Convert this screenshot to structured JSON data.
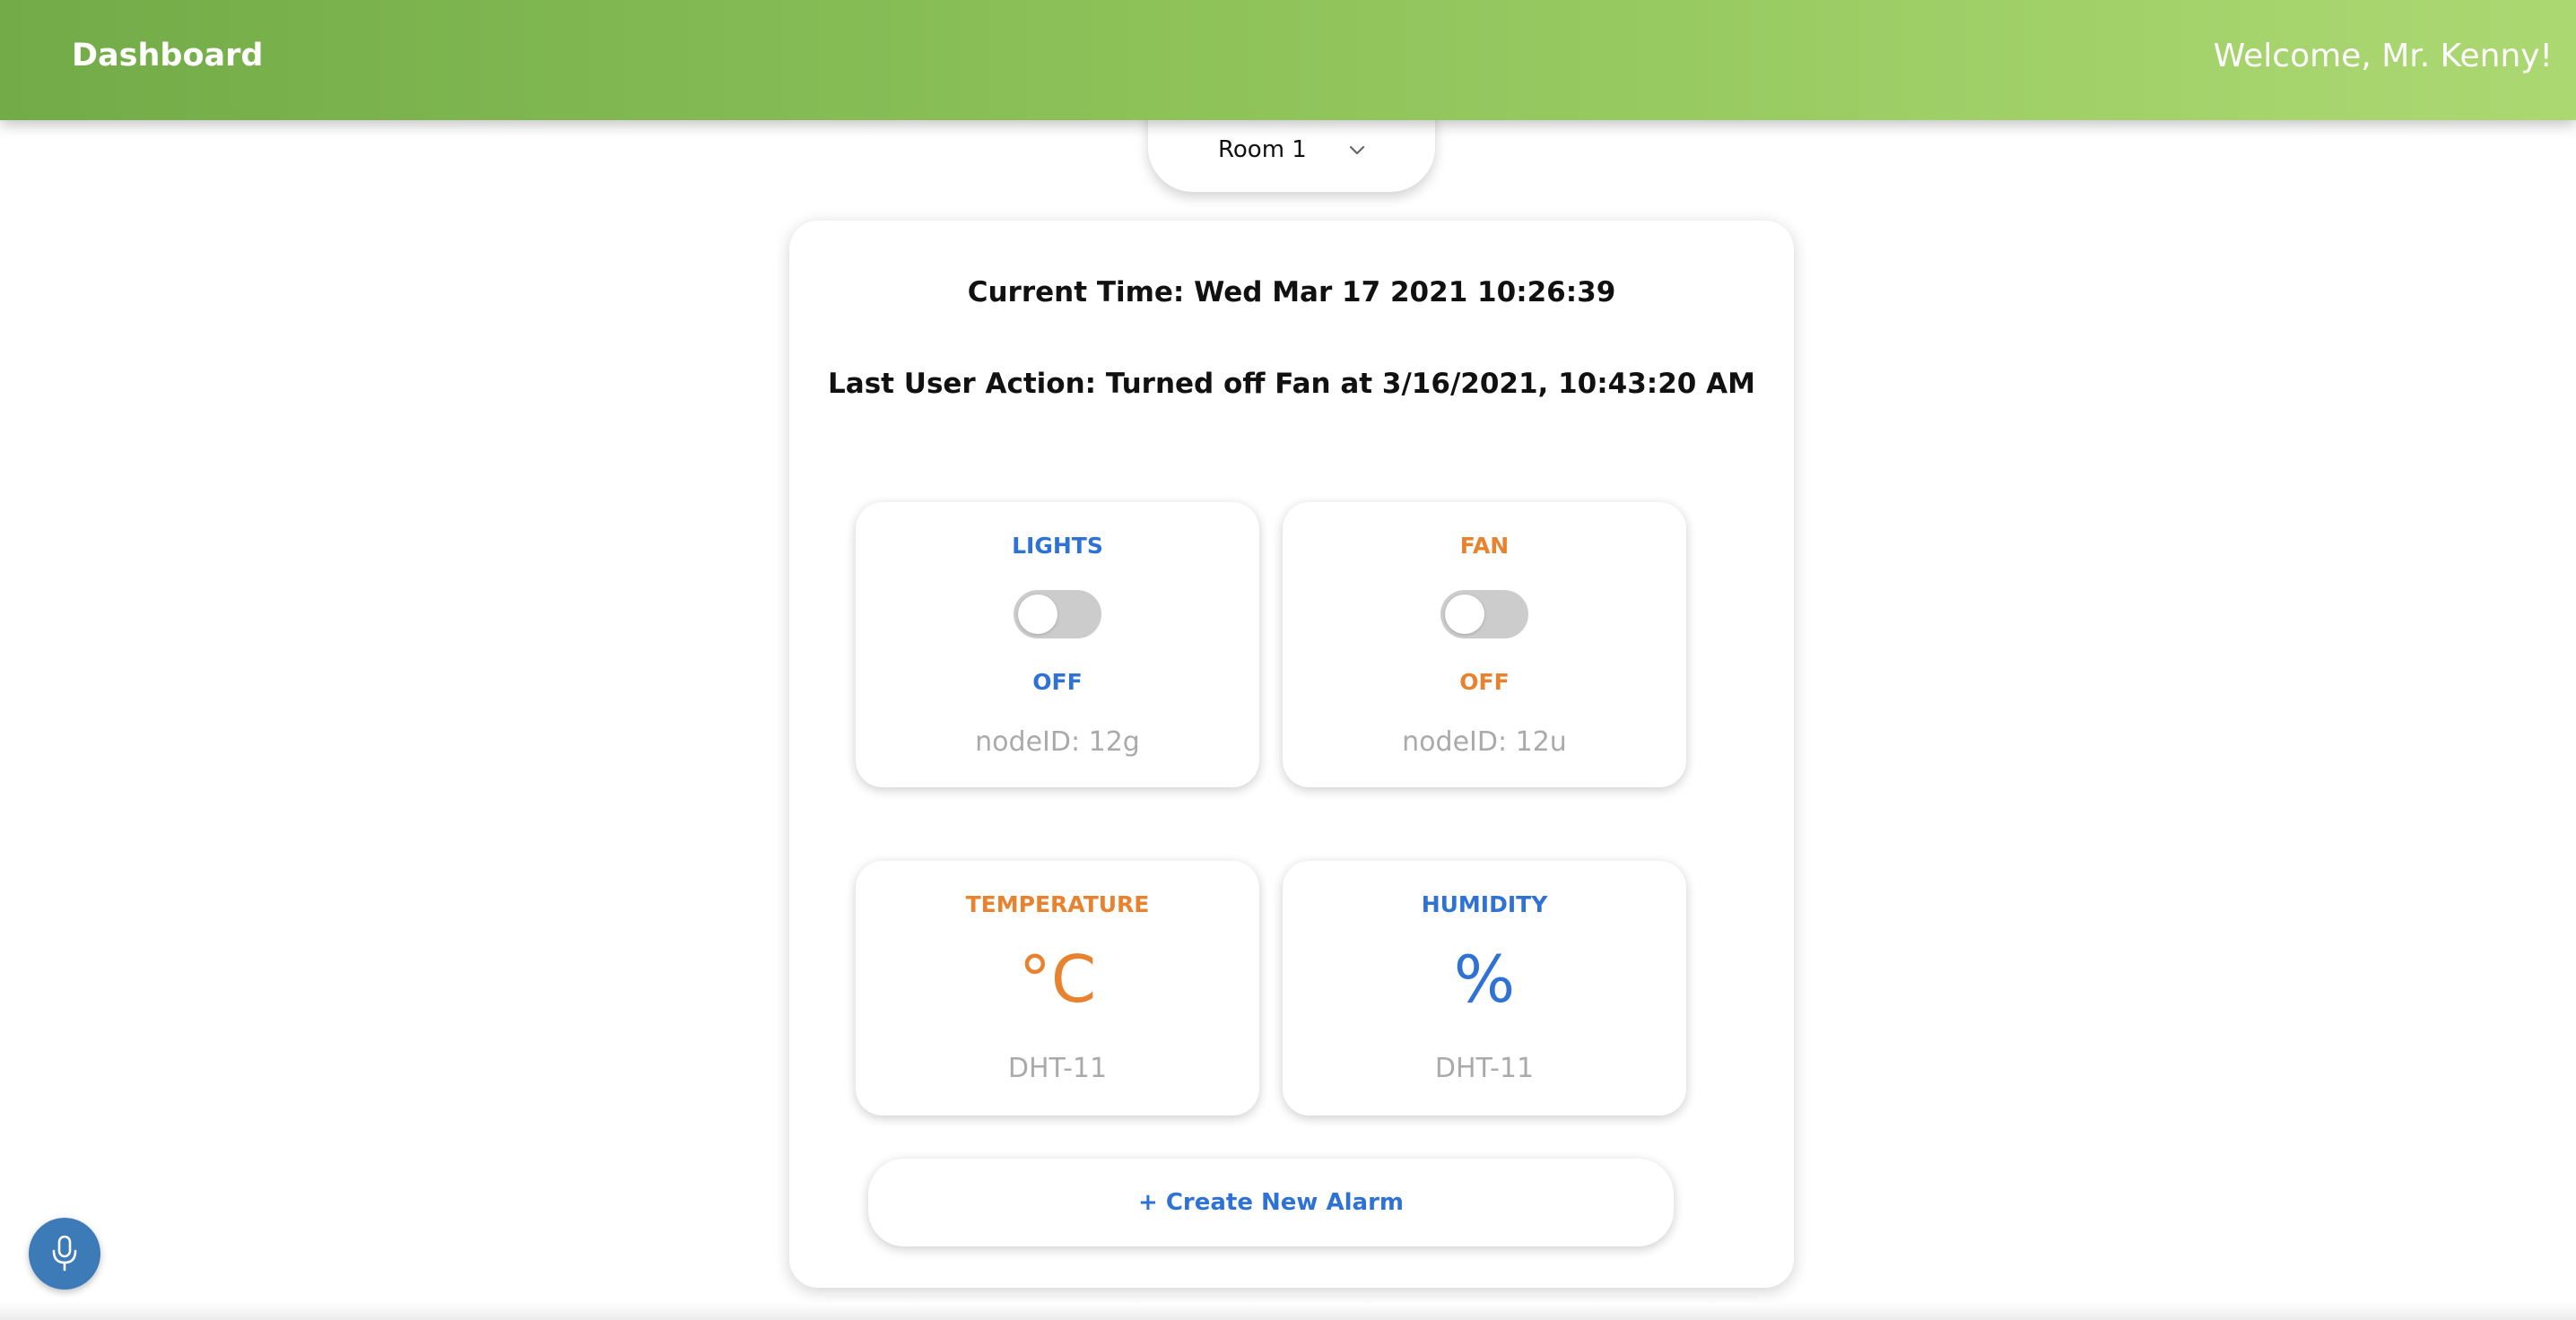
{
  "header": {
    "title": "Dashboard",
    "welcome": "Welcome, Mr. Kenny!"
  },
  "room_selector": {
    "selected": "Room 1"
  },
  "status": {
    "current_time": "Current Time: Wed Mar 17 2021 10:26:39",
    "last_action": "Last User Action: Turned off Fan at 3/16/2021, 10:43:20 AM"
  },
  "devices": [
    {
      "title": "LIGHTS",
      "state": "OFF",
      "node": "nodeID: 12g",
      "on": false
    },
    {
      "title": "FAN",
      "state": "OFF",
      "node": "nodeID: 12u",
      "on": false
    }
  ],
  "sensors": [
    {
      "title": "TEMPERATURE",
      "value": "°C",
      "source": "DHT-11"
    },
    {
      "title": "HUMIDITY",
      "value": "%",
      "source": "DHT-11"
    }
  ],
  "alarm": {
    "label": "+ Create New Alarm"
  },
  "icons": {
    "room_dropdown": "chevron-down-icon",
    "voice": "microphone-icon"
  },
  "colors": {
    "header_start": "#72ab48",
    "header_end": "#acd872",
    "blue": "#2f72d6",
    "orange": "#e8822e",
    "mic_button": "#3d7ab8",
    "muted_text": "#aaaaaa",
    "toggle_off": "#cccccc"
  }
}
